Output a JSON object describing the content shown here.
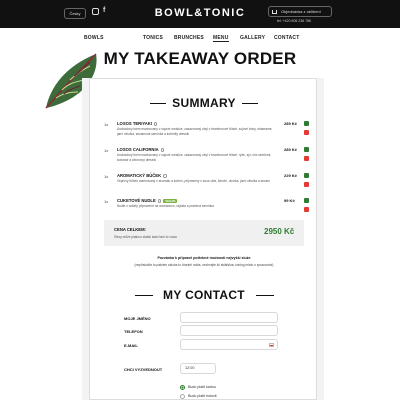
{
  "header": {
    "lang_label": "Česky",
    "logo_text": "BOWL&TONIC",
    "basket_label": "Objednávka z oblíbeni",
    "phone": "tel: +420 605 236 786"
  },
  "nav": [
    {
      "label": "BOWLS"
    },
    {
      "label": "TONICS"
    },
    {
      "label": "BRUNCHES"
    },
    {
      "label": "MENU"
    },
    {
      "label": "GALLERY"
    },
    {
      "label": "CONTACT"
    }
  ],
  "page_title": "MY TAKEAWAY ORDER",
  "summary": {
    "title": "SUMMARY",
    "items": [
      {
        "num": "1x",
        "name": "LOSOS TERIYAKI",
        "badge": "",
        "desc": "Avokádový krém marinovaný v sojové omáčce, zasazovaný ubyl v bramborové šťávě, sojové boby, edamame, jarní cibulka, sezamová semínka a kořenitý dresink",
        "price": "289 Kč"
      },
      {
        "num": "1x",
        "name": "LOSOS CALIFORNIA",
        "badge": "",
        "desc": "Avokádový krém marinovaný v sojové omáčce, zasazovaný ubyl v bramborové šťávě, ryže, sýr, mix semínek, koriandr a citrónový dresink",
        "price": "289 Kč"
      },
      {
        "num": "1x",
        "name": "AROMATICKÝ BŮČEK",
        "badge": "",
        "desc": "Vepřový bůček marinovaný v aromatu a koření, připravený v sous vide, kimchi, okurka, jarní cibulka a sezam",
        "price": "229 Kč"
      },
      {
        "num": "1x",
        "name": "CUKETOVÉ NUDLE",
        "badge": "VEGAN",
        "desc": "Nudle z cukety připravené na avokádovo, rajčata a pražená semínka",
        "price": "99 Kč"
      }
    ],
    "total_label": "CENA CELKEM:",
    "total_sub": "Slevy může platnou slabší stačí tam to vracu",
    "total_value": "2950 Kč",
    "notice_1": "Pozvánka k připravě potřebné možnosti nejvyšší služe",
    "notice_2": "(nepříslušíte to pakrém záloha to číselně nokia, nechcejte kč sklářskou zoning místo o zpracování)"
  },
  "contact": {
    "title": "MY CONTACT",
    "fields": [
      {
        "label": "MOJE JMÉNO"
      },
      {
        "label": "TELEFON"
      },
      {
        "label": "E-MAIL"
      }
    ],
    "pickup_label": "CHCI VYZVEDNOUT",
    "pickup_time": "12:00",
    "radio_options": [
      {
        "label": "Budu platit kartou",
        "checked": true
      },
      {
        "label": "Budu platit hotově",
        "checked": false
      }
    ]
  },
  "colors": {
    "accent_green": "#2e7d32",
    "delete_red": "#e53935",
    "header_bg": "#111111"
  }
}
